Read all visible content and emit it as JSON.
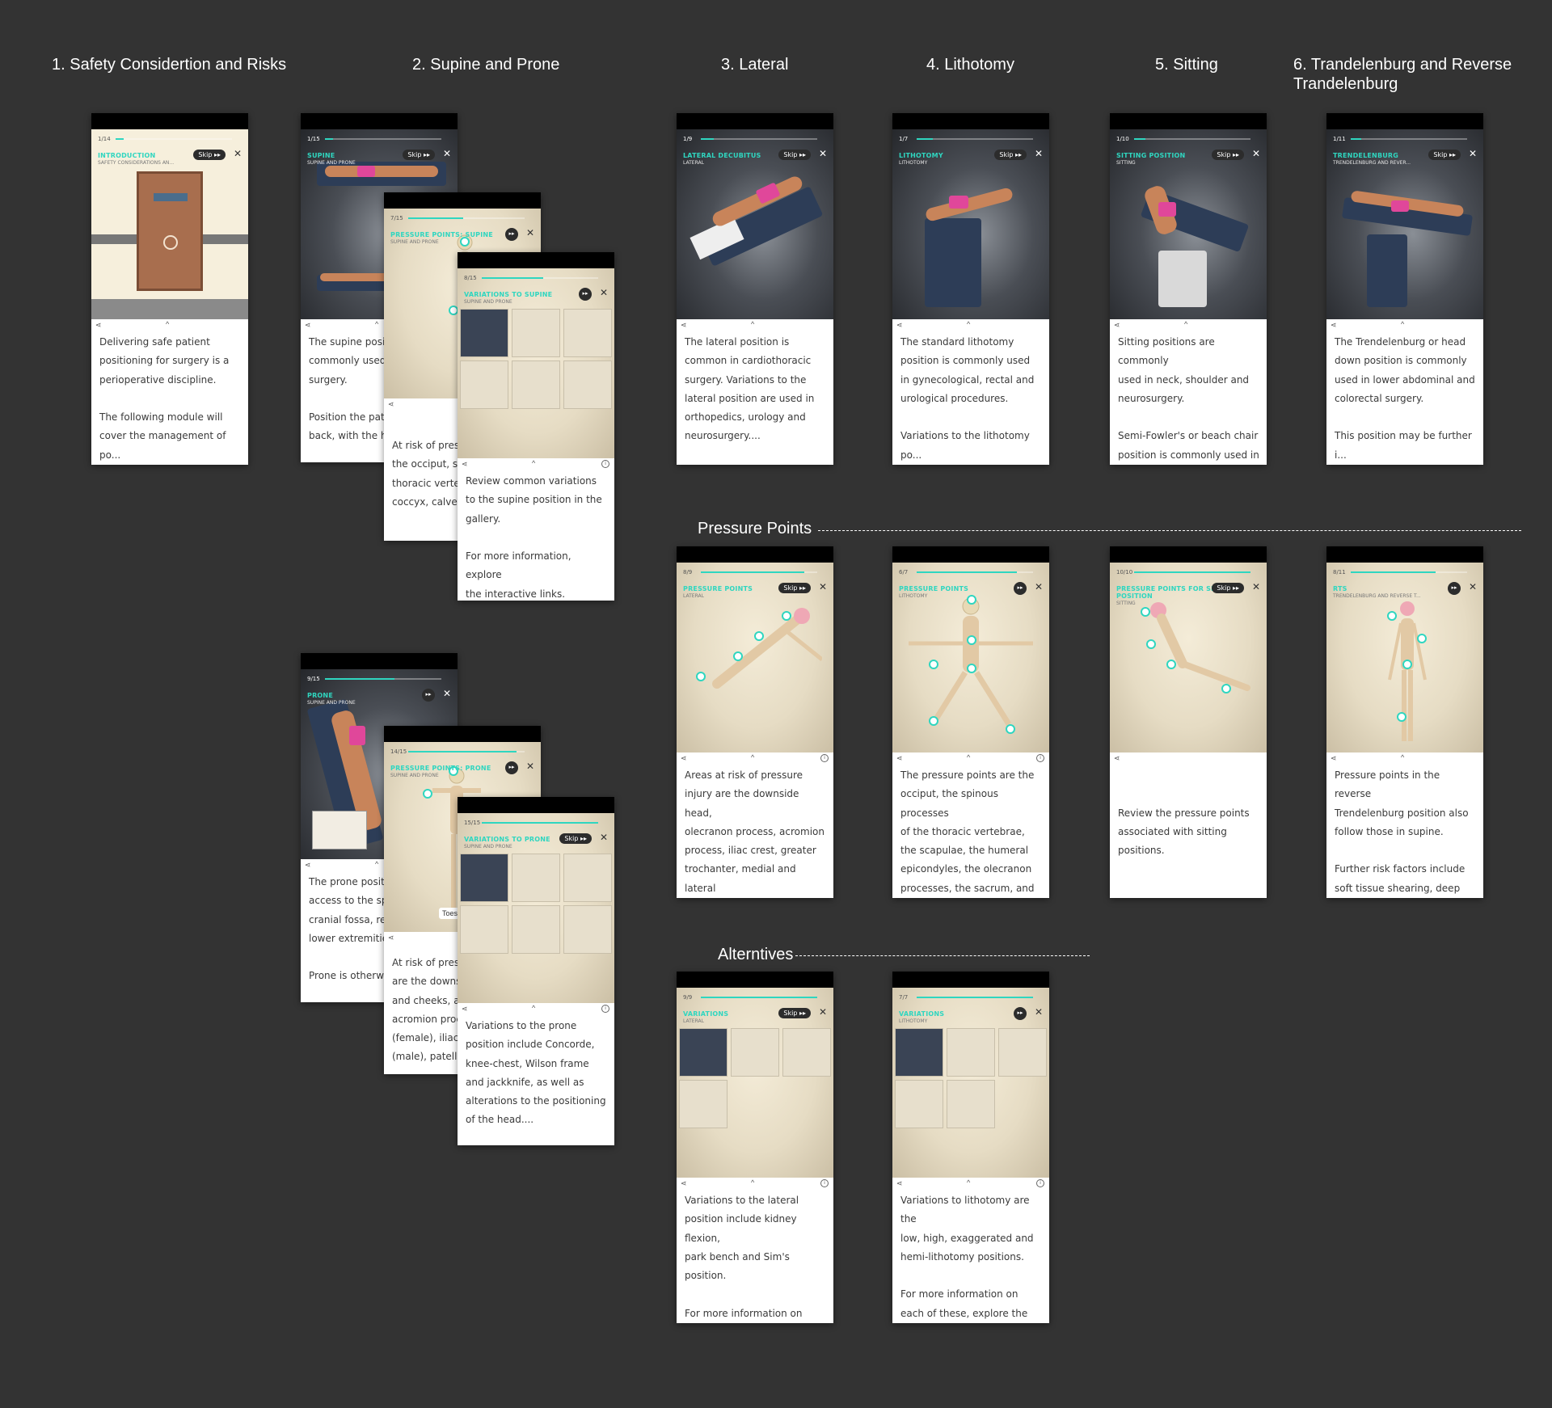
{
  "columns": [
    {
      "title": "1. Safety Considertion and Risks"
    },
    {
      "title": "2. Supine and Prone"
    },
    {
      "title": "3. Lateral"
    },
    {
      "title": "4. Lithotomy"
    },
    {
      "title": "5. Sitting"
    },
    {
      "title": "6. Trandelenburg and Reverse Trandelenburg"
    }
  ],
  "sections": {
    "pressure_points": "Pressure Points",
    "alternatives": "Alterntives"
  },
  "labels": {
    "skip": "Skip ▸▸",
    "ff": "▸▸",
    "close": "✕",
    "share": "⋖",
    "caret": "^",
    "info": "i",
    "toes": "Toes"
  },
  "screens": {
    "safety": {
      "step": "1/14",
      "title": "INTRODUCTION",
      "subtitle": "SAFETY CONSIDERATIONS AN...",
      "body": "Delivering safe patient\npositioning for surgery is a\nperioperative discipline.\n\nThe following module will\ncover the management of po..."
    },
    "supine": {
      "step": "1/15",
      "title": "SUPINE",
      "subtitle": "SUPINE AND PRONE",
      "body": "The supine posit\ncommonly used i\nsurgery.\n\nPosition the pati\nback, with the he"
    },
    "supine_pp": {
      "step": "7/15",
      "title": "PRESSURE POINTS: SUPINE",
      "subtitle": "SUPINE AND PRONE",
      "body": "At risk of press\nthe occiput, sc\nthoracic verteb\ncoccyx, calves"
    },
    "supine_var": {
      "step": "8/15",
      "title": "VARIATIONS TO SUPINE",
      "subtitle": "SUPINE AND PRONE",
      "body": "Review common variations\nto the supine position in the\ngallery.\n\nFor more information, explore\nthe interactive links."
    },
    "prone": {
      "step": "9/15",
      "title": "PRONE",
      "subtitle": "SUPINE AND PRONE",
      "body": "The prone positi\naccess to the spi\ncranial fossa, rec\nlower extremitie\n\nProne is otherwi"
    },
    "prone_pp": {
      "step": "14/15",
      "title": "PRESSURE POINTS: PRONE",
      "subtitle": "SUPINE AND PRONE",
      "body": "At risk of press\nare the downs\nand cheeks, as\nacromion proc\n(female), iliac c\n(male), patella"
    },
    "prone_var": {
      "step": "15/15",
      "title": "VARIATIONS TO PRONE",
      "subtitle": "SUPINE AND PRONE",
      "body": "Variations to the prone\nposition include Concorde,\nknee-chest, Wilson frame\nand jackknife, as well as\nalterations to the positioning\nof the head...."
    },
    "lateral": {
      "step": "1/9",
      "title": "LATERAL DECUBITUS",
      "subtitle": "LATERAL",
      "body": "The lateral position is\ncommon in cardiothoracic\nsurgery. Variations to the\nlateral position are used in\northopedics, urology and\nneurosurgery...."
    },
    "lithotomy": {
      "step": "1/7",
      "title": "LITHOTOMY",
      "subtitle": "LITHOTOMY",
      "body": "The standard lithotomy\nposition is commonly used\nin gynecological, rectal and\nurological procedures.\n\nVariations to the lithotomy po..."
    },
    "sitting": {
      "step": "1/10",
      "title": "SITTING POSITION",
      "subtitle": "SITTING",
      "body": "Sitting positions are commonly\nused in neck, shoulder and\nneurosurgery.\n\nSemi-Fowler's or beach chair\nposition is commonly used in ..."
    },
    "trendelenburg": {
      "step": "1/11",
      "title": "TRENDELENBURG",
      "subtitle": "TRENDELENBURG AND REVER...",
      "body": "The Trendelenburg or head\ndown position is commonly\nused in lower abdominal and\ncolorectal surgery.\n\nThis position may be further i..."
    },
    "lateral_pp": {
      "step": "8/9",
      "title": "PRESSURE POINTS",
      "subtitle": "LATERAL",
      "body": "Areas at risk of pressure\ninjury are the downside head,\nolecranon process, acromion\nprocess, iliac crest, greater\ntrochanter, medial and lateral\ncondyles of the femur and m..."
    },
    "lithotomy_pp": {
      "step": "6/7",
      "title": "PRESSURE POINTS",
      "subtitle": "LITHOTOMY",
      "body": "The pressure points are the\nocciput, the spinous processes\nof the thoracic vertebrae,\nthe scapulae, the humeral\nepicondyles, the olecranon\nprocesses, the sacrum, and t..."
    },
    "sitting_pp": {
      "step": "10/10",
      "title": "PRESSURE POINTS FOR SITTING POSITION",
      "subtitle": "SITTING",
      "body": "\n\nReview the pressure points\nassociated with sitting\npositions."
    },
    "trend_pp": {
      "step": "8/11",
      "title": "RTS",
      "subtitle": "TRENDELENBURG AND REVERSE T...",
      "body": "Pressure points in the reverse\nTrendelenburg position also\nfollow those in supine.\n\nFurther risk factors include\nsoft tissue shearing, deep vei..."
    },
    "lateral_alt": {
      "step": "9/9",
      "title": "VARIATIONS",
      "subtitle": "LATERAL",
      "body": "Variations to the lateral\nposition include kidney flexion,\npark bench and Sim's position.\n\nFor more information on\neach of these, explore the int..."
    },
    "lithotomy_alt": {
      "step": "7/7",
      "title": "VARIATIONS",
      "subtitle": "LITHOTOMY",
      "body": "Variations to lithotomy are the\nlow, high, exaggerated and\nhemi-lithotomy positions.\n\nFor more information on\neach of these, explore the int..."
    }
  },
  "progress": {
    "safety": 0.07,
    "supine": 0.07,
    "supine_pp": 0.47,
    "supine_var": 0.53,
    "prone": 0.6,
    "prone_pp": 0.93,
    "prone_var": 1.0,
    "lateral": 0.11,
    "lithotomy": 0.14,
    "sitting": 0.1,
    "trendelenburg": 0.09,
    "lateral_pp": 0.89,
    "lithotomy_pp": 0.86,
    "sitting_pp": 1.0,
    "trend_pp": 0.73,
    "lateral_alt": 1.0,
    "lithotomy_alt": 1.0
  },
  "colors": {
    "accent": "#2fd6c0",
    "background": "#333333",
    "suit": "#e0479a",
    "table": "#2d3d57"
  }
}
